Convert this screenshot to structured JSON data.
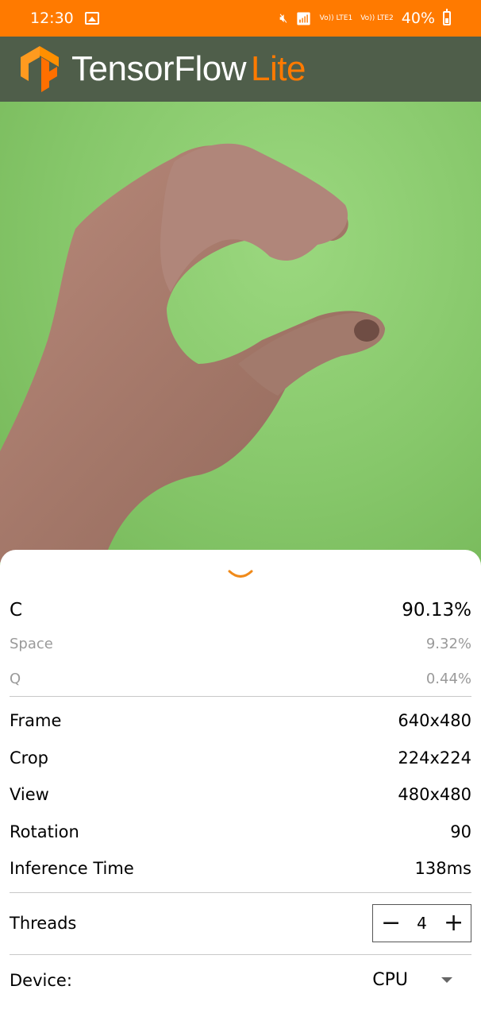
{
  "status_bar": {
    "time": "12:30",
    "net1": "Vo)) LTE1",
    "net2": "Vo)) LTE2",
    "battery": "40%"
  },
  "app_bar": {
    "title_main": "TensorFlow",
    "title_accent": "Lite",
    "accent_color": "#ff7a00"
  },
  "results": [
    {
      "label": "C",
      "value": "90.13%"
    },
    {
      "label": "Space",
      "value": "9.32%"
    },
    {
      "label": "Q",
      "value": "0.44%"
    }
  ],
  "stats": [
    {
      "label": "Frame",
      "value": "640x480"
    },
    {
      "label": "Crop",
      "value": "224x224"
    },
    {
      "label": "View",
      "value": "480x480"
    },
    {
      "label": "Rotation",
      "value": "90"
    },
    {
      "label": "Inference Time",
      "value": "138ms"
    }
  ],
  "threads": {
    "label": "Threads",
    "minus": "−",
    "value": "4",
    "plus": "+"
  },
  "device": {
    "label": "Device:",
    "value": "CPU"
  }
}
